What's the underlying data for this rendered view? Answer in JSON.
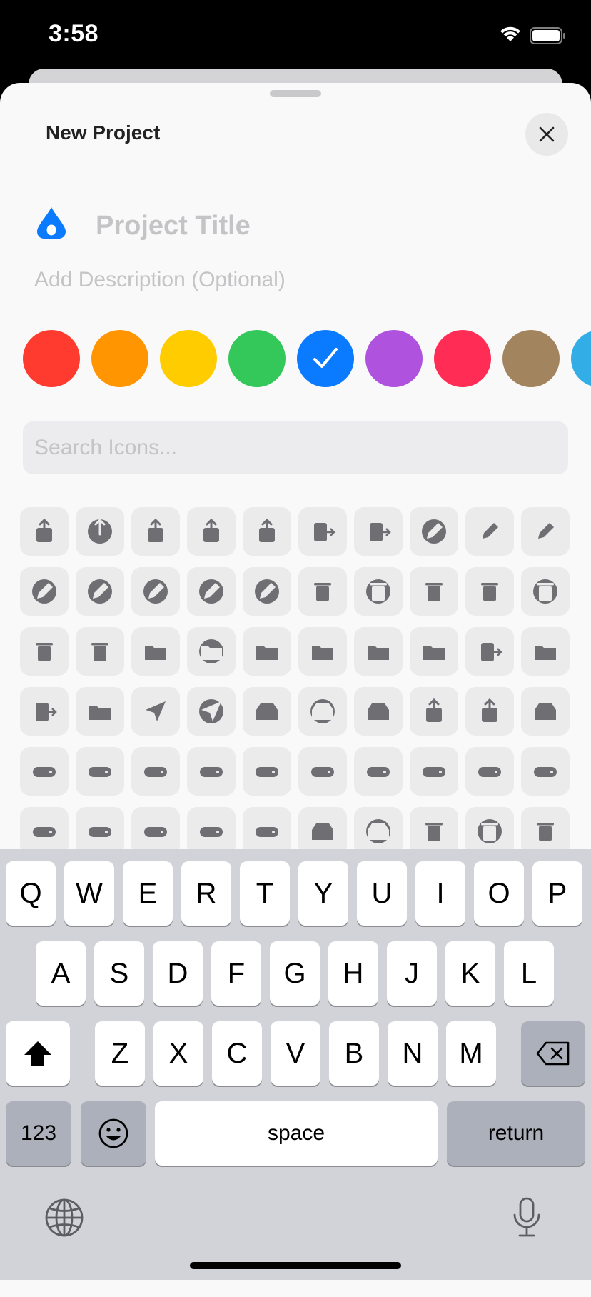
{
  "status_bar": {
    "time": "3:58",
    "wifi_icon": "wifi-icon",
    "battery_icon": "battery-icon"
  },
  "sheet": {
    "title": "New Project",
    "close_icon": "close-icon"
  },
  "project": {
    "icon": "drop-icon",
    "icon_color": "#0a7aff",
    "title_placeholder": "Project Title",
    "title_value": "",
    "description_placeholder": "Add Description (Optional)",
    "description_value": ""
  },
  "colors": [
    {
      "name": "red",
      "hex": "#ff3b30",
      "selected": false
    },
    {
      "name": "orange",
      "hex": "#ff9500",
      "selected": false
    },
    {
      "name": "yellow",
      "hex": "#ffcc00",
      "selected": false
    },
    {
      "name": "green",
      "hex": "#34c759",
      "selected": false
    },
    {
      "name": "blue",
      "hex": "#0a7aff",
      "selected": true
    },
    {
      "name": "purple",
      "hex": "#af52de",
      "selected": false
    },
    {
      "name": "pink",
      "hex": "#ff2d55",
      "selected": false
    },
    {
      "name": "brown",
      "hex": "#a2845e",
      "selected": false
    },
    {
      "name": "cyan",
      "hex": "#32ade6",
      "selected": false
    }
  ],
  "search": {
    "placeholder": "Search Icons...",
    "value": ""
  },
  "icon_grid": [
    [
      "square-and-arrow-up",
      "square-and-arrow-up-circle",
      "square-and-arrow-down",
      "square-and-arrow-up-on-square",
      "square-and-arrow-down-on-square",
      "rectangle-portrait-and-arrow-right",
      "rectangle-portrait-and-arrow-forward",
      "pencil-circle",
      "eraser",
      "eraser-line-dashed"
    ],
    [
      "square-and-pencil-circle",
      "pencil-tip-circle",
      "pencil-tip-crop-circle-badge-plus",
      "pencil-tip-crop-circle-badge-minus",
      "pencil-tip-crop-circle-badge-arrow-forward",
      "trash",
      "trash-circle",
      "trash-square",
      "trash-slash",
      "trash-slash-circle"
    ],
    [
      "trash-slash-square",
      "trash-arrow-up",
      "folder",
      "folder-circle",
      "folder-badge-plus",
      "folder-badge-minus",
      "folder-badge-questionmark",
      "folder-badge-person-crop",
      "rectangle-stack-badge-plus",
      "folder-badge-gearshape"
    ],
    [
      "rectangle-stack-badge-plus-fill",
      "questionmark-folder",
      "paperplane",
      "paperplane-circle",
      "tray",
      "tray-circle",
      "tray-2",
      "tray-and-arrow-up",
      "tray-and-arrow-down",
      "tray-full"
    ],
    [
      "externaldrive",
      "externaldrive-badge-plus",
      "externaldrive-badge-minus",
      "externaldrive-badge-checkmark",
      "externaldrive-badge-xmark",
      "externaldrive-badge-questionmark",
      "externaldrive-badge-exclamationmark",
      "externaldrive-badge-person-crop",
      "externaldrive-badge-wifi",
      "externaldrive-badge-icloud"
    ],
    [
      "externaldrive-trianglebadge-exclamationmark",
      "externaldrive-badge-timemachine",
      "internaldrive",
      "opticaldiscdrive",
      "externaldrive-connected-to-line-below",
      "archivebox",
      "archivebox-circle",
      "xmark-bin",
      "xmark-bin-circle",
      "arrow-up-bin"
    ]
  ],
  "keyboard": {
    "row1": [
      "Q",
      "W",
      "E",
      "R",
      "T",
      "Y",
      "U",
      "I",
      "O",
      "P"
    ],
    "row2": [
      "A",
      "S",
      "D",
      "F",
      "G",
      "H",
      "J",
      "K",
      "L"
    ],
    "row3": [
      "Z",
      "X",
      "C",
      "V",
      "B",
      "N",
      "M"
    ],
    "shift_icon": "shift-icon",
    "delete_icon": "delete-icon",
    "numbers_label": "123",
    "emoji_icon": "emoji-icon",
    "space_label": "space",
    "return_label": "return",
    "globe_icon": "globe-icon",
    "mic_icon": "microphone-icon"
  }
}
